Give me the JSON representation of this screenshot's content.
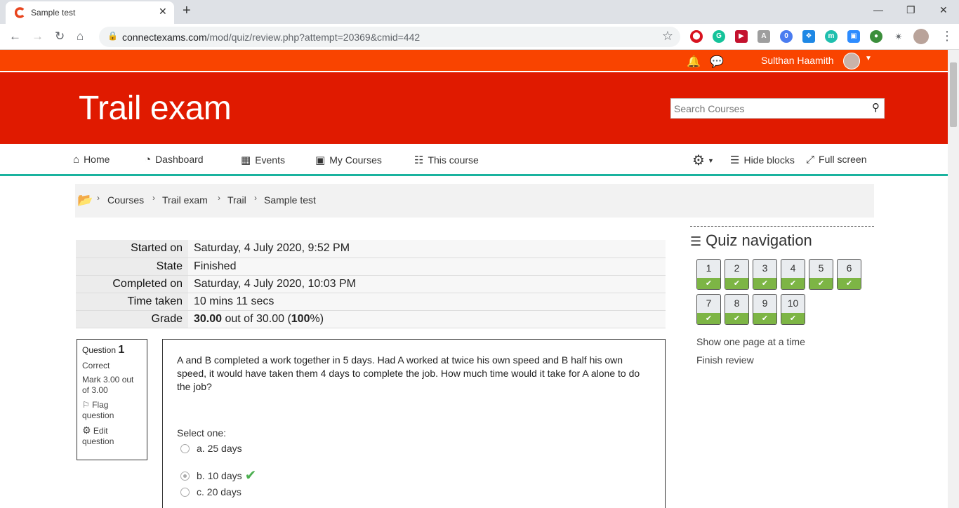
{
  "browser": {
    "tab_title": "Sample test",
    "tab_close": "✕",
    "new_tab": "+",
    "url_host": "connectexams.com",
    "url_path": "/mod/quiz/review.php?attempt=20369&cmid=442",
    "ext_badge": "0"
  },
  "usernav": {
    "username": "Sulthan Haamith"
  },
  "header": {
    "title": "Trail exam",
    "search_placeholder": "Search Courses"
  },
  "nav": {
    "items": [
      "Home",
      "Dashboard",
      "Events",
      "My Courses",
      "This course"
    ],
    "hide_blocks": "Hide blocks",
    "full_screen": "Full screen"
  },
  "breadcrumb": [
    "Courses",
    "Trail exam",
    "Trail",
    "Sample test"
  ],
  "summary": {
    "rows": [
      {
        "label": "Started on",
        "value": "Saturday, 4 July 2020, 9:52 PM"
      },
      {
        "label": "State",
        "value": "Finished"
      },
      {
        "label": "Completed on",
        "value": "Saturday, 4 July 2020, 10:03 PM"
      },
      {
        "label": "Time taken",
        "value": "10 mins 11 secs"
      },
      {
        "label": "Grade",
        "value_bold": "30.00",
        "value_mid": " out of 30.00 (",
        "value_pct": "100",
        "value_end": "%)"
      }
    ]
  },
  "question": {
    "label": "Question",
    "number": "1",
    "state": "Correct",
    "mark": "Mark 3.00 out of 3.00",
    "flag": "Flag question",
    "edit": "Edit question",
    "text": "A and B completed a work together in 5 days. Had A worked at twice his own speed and B half his own speed, it would have taken them 4 days to complete the job. How much time would it take for A alone to do the job?",
    "prompt": "Select one:",
    "options": [
      "a. 25 days",
      "b. 10 days",
      "c. 20 days"
    ],
    "selected_index": 1
  },
  "quiz_navigation": {
    "title": "Quiz navigation",
    "questions": [
      "1",
      "2",
      "3",
      "4",
      "5",
      "6",
      "7",
      "8",
      "9",
      "10"
    ],
    "show_one_page": "Show one page at a time",
    "finish_review": "Finish review"
  },
  "colors": {
    "usernav_bg": "#f94400",
    "header_bg": "#e01a00",
    "nav_border": "#1ab39f",
    "correct_green": "#7db545"
  }
}
